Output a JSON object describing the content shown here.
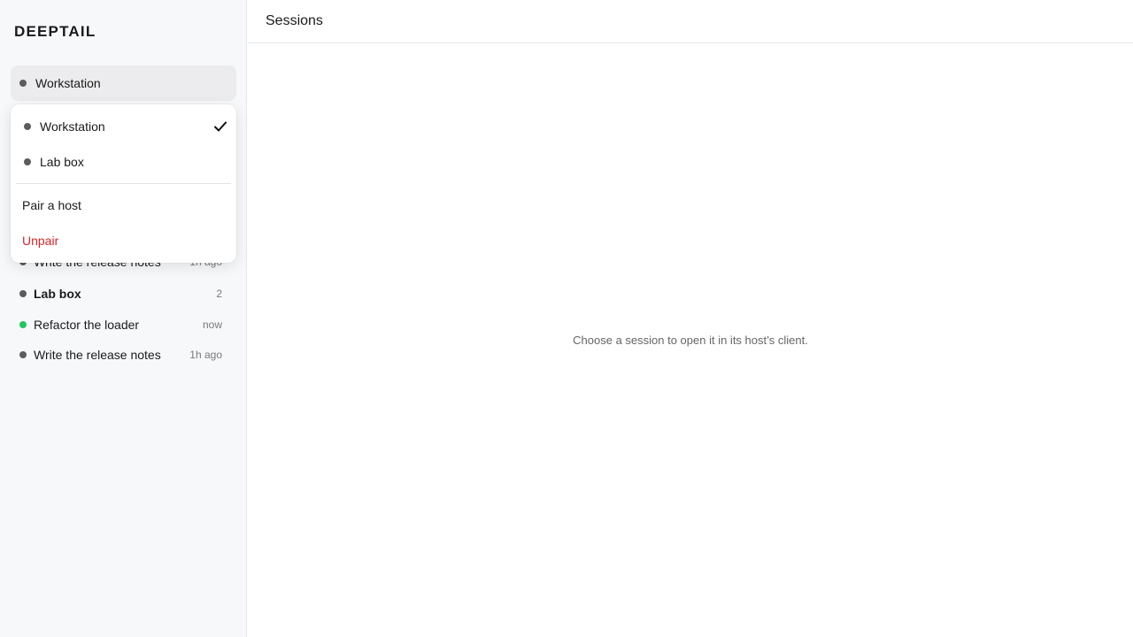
{
  "brand": "DEEPTAIL",
  "host_select": {
    "selected": "Workstation"
  },
  "dropdown": {
    "hosts": [
      {
        "label": "Workstation",
        "selected": true
      },
      {
        "label": "Lab box",
        "selected": false
      }
    ],
    "pair_label": "Pair a host",
    "unpair_label": "Unpair"
  },
  "sessions": {
    "partial_row": {
      "label": "Write the release notes",
      "meta": "1h ago"
    },
    "group": {
      "label": "Lab box",
      "count": "2"
    },
    "items": [
      {
        "label": "Refactor the loader",
        "meta": "now",
        "status": "active"
      },
      {
        "label": "Write the release notes",
        "meta": "1h ago",
        "status": "idle"
      }
    ]
  },
  "main": {
    "title": "Sessions",
    "empty_message": "Choose a session to open it in its host’s client."
  },
  "colors": {
    "active_dot": "#22c55e",
    "idle_dot": "#5c5c5c",
    "danger": "#dc2626"
  }
}
